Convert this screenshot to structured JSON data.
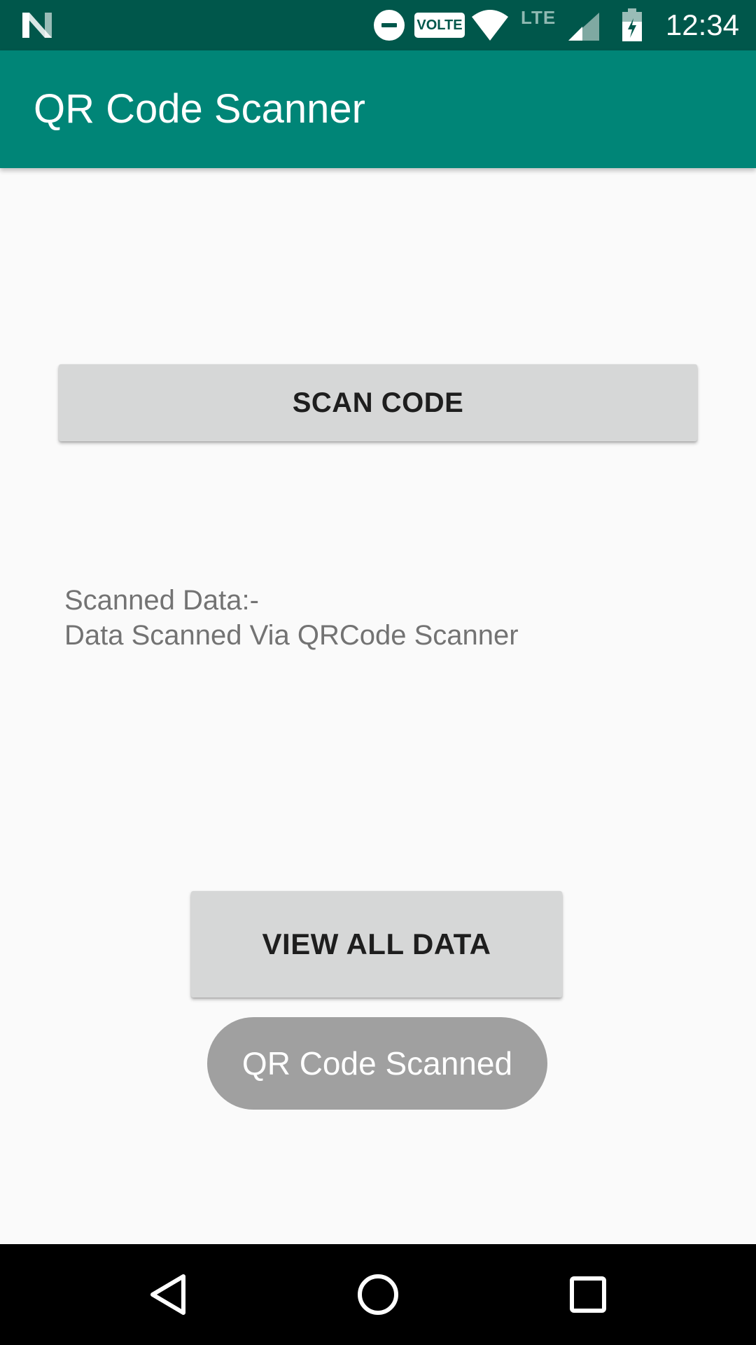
{
  "status_bar": {
    "time": "12:34",
    "volte": "VOLTE",
    "network": "LTE",
    "icons": [
      "n-logo-icon",
      "dnd-icon",
      "wifi-icon",
      "signal-icon",
      "battery-charging-icon"
    ]
  },
  "app_bar": {
    "title": "QR Code Scanner",
    "color": "#008577"
  },
  "main": {
    "scan_button": "SCAN CODE",
    "scanned_label": "Scanned Data:-",
    "scanned_value": "Data Scanned Via QRCode Scanner",
    "view_all_button": "VIEW ALL DATA"
  },
  "toast": {
    "message": "QR Code Scanned"
  },
  "nav_bar": {
    "icons": [
      "back-icon",
      "home-icon",
      "recents-icon"
    ]
  }
}
